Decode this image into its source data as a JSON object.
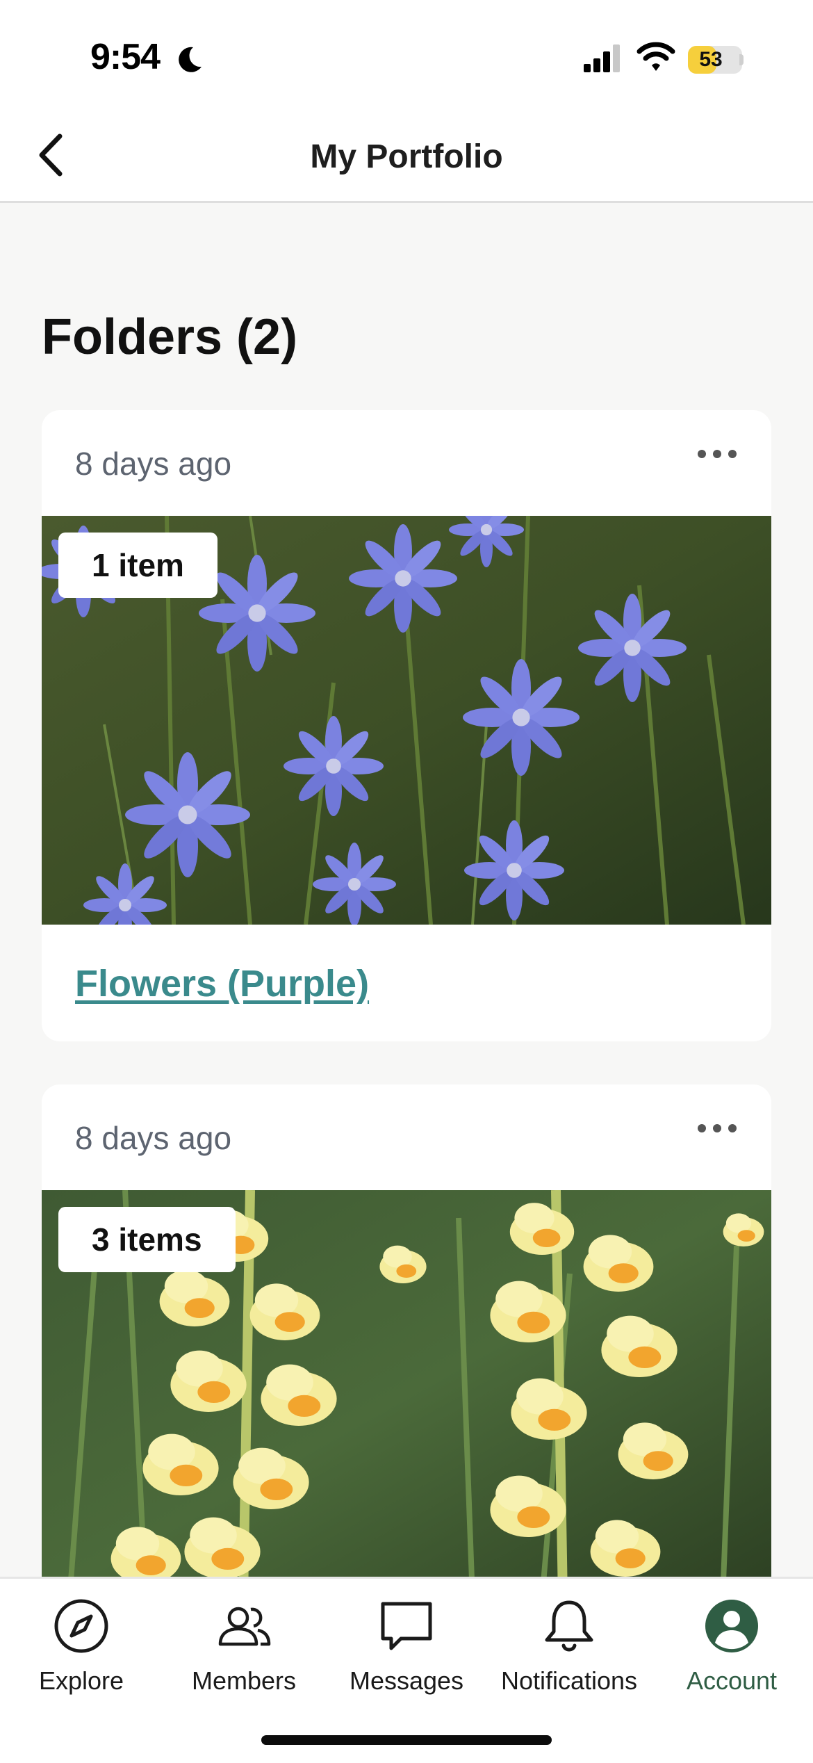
{
  "status_bar": {
    "time": "9:54",
    "battery": "53",
    "battery_level": 0.53,
    "battery_color": "#f6cf3c",
    "icons": [
      "moon-icon",
      "signal-icon",
      "wifi-icon",
      "battery-icon"
    ]
  },
  "header": {
    "title": "My Portfolio",
    "back_icon": "chevron-left-icon"
  },
  "section": {
    "heading": "Folders (2)"
  },
  "folders": [
    {
      "date": "8 days ago",
      "count": "1 item",
      "name": "Flowers (Purple)",
      "image": "purple chicory flowers",
      "more_icon": "more-horizontal-icon"
    },
    {
      "date": "8 days ago",
      "count": "3 items",
      "name": "",
      "image": "yellow toadflax flowers",
      "more_icon": "more-horizontal-icon"
    }
  ],
  "tabs": [
    {
      "label": "Explore",
      "icon": "compass-icon",
      "active": false
    },
    {
      "label": "Members",
      "icon": "members-icon",
      "active": false
    },
    {
      "label": "Messages",
      "icon": "message-icon",
      "active": false
    },
    {
      "label": "Notifications",
      "icon": "bell-icon",
      "active": false
    },
    {
      "label": "Account",
      "icon": "account-icon",
      "active": true
    }
  ],
  "colors": {
    "link": "#3a8a8c",
    "active_tab": "#2f5d44",
    "background": "#f7f7f6"
  }
}
